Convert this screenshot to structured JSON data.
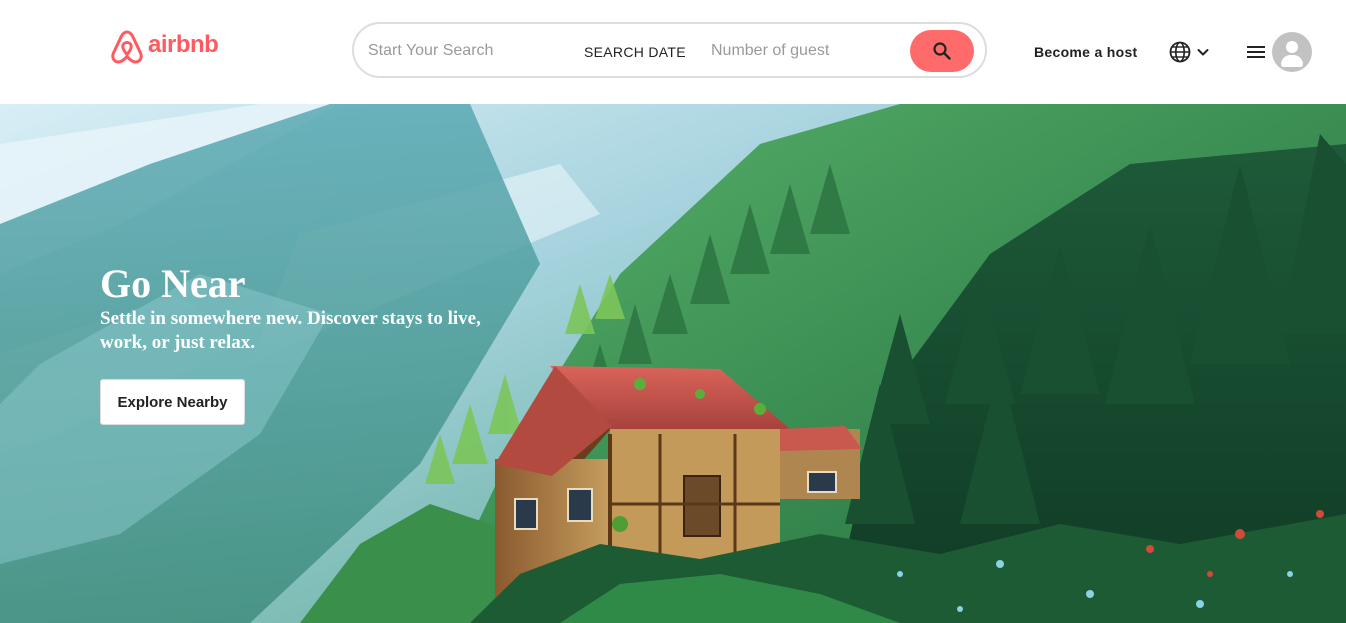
{
  "header": {
    "logo_text": "airbnb",
    "brand_color": "#FF5A5F",
    "search": {
      "placeholder": "Start Your Search",
      "date_label": "SEARCH DATE",
      "guest_placeholder": "Number of guest",
      "button_icon": "search-icon",
      "button_color": "#FF6B6B"
    },
    "become_host_label": "Become a host",
    "language_icon": "globe-icon",
    "menu_icon": "hamburger-menu-icon",
    "avatar_icon": "user-avatar-icon"
  },
  "hero": {
    "title": "Go Near",
    "subtitle": "Settle in somewhere new. Discover stays to live, work, or just relax.",
    "cta_label": "Explore Nearby"
  }
}
